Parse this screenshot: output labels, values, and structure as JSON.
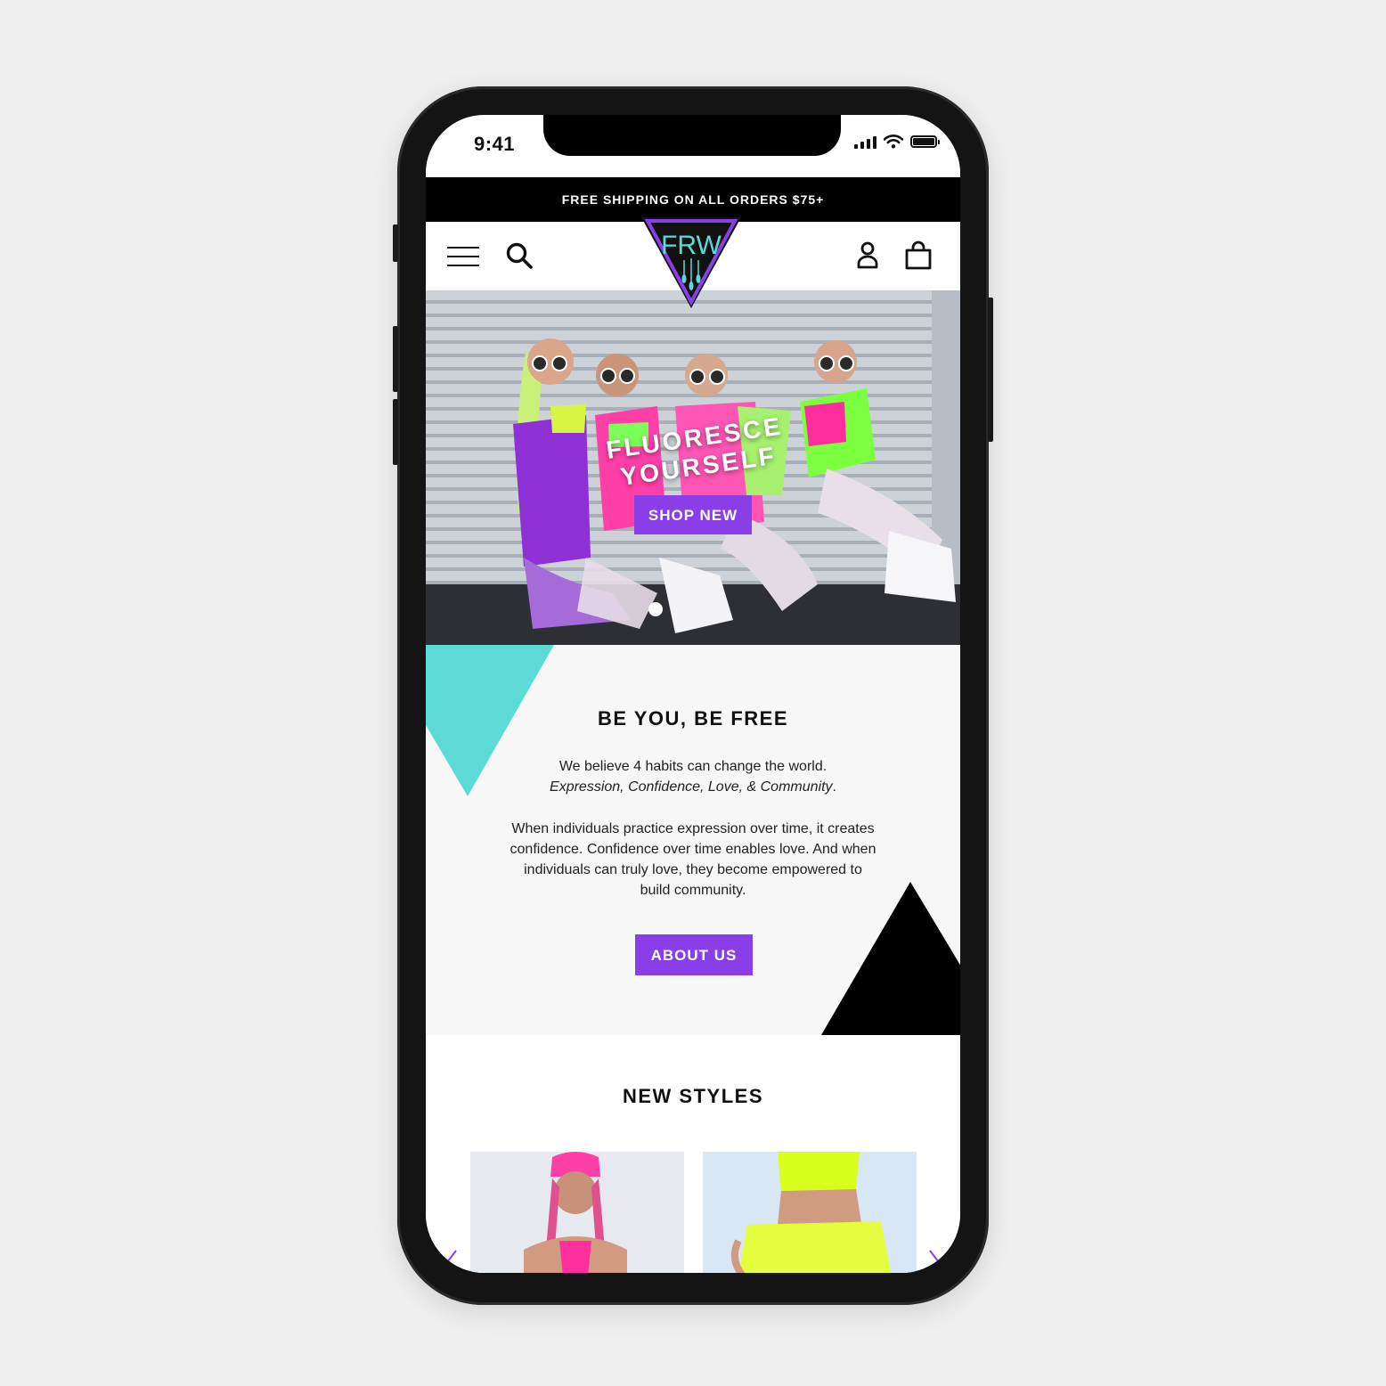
{
  "status": {
    "time": "9:41"
  },
  "promo": {
    "text": "FREE SHIPPING ON ALL ORDERS $75+"
  },
  "brand": {
    "logo_text": "FRW",
    "accent": "#8a3ee8",
    "teal": "#5ddad6"
  },
  "hero": {
    "title": "FLUORESCE YOURSELF",
    "cta": "SHOP NEW"
  },
  "about": {
    "heading": "BE YOU, BE FREE",
    "line1": "We believe 4 habits can change the world.",
    "line2": "Expression, Confidence, Love, & Community",
    "line2_end": ".",
    "body": "When individuals practice expression over time, it creates confidence. Confidence over time enables love. And when individuals can truly love, they become empowered to build community.",
    "cta": "ABOUT US"
  },
  "styles": {
    "heading": "NEW STYLES"
  },
  "icons": [
    "menu-icon",
    "search-icon",
    "account-icon",
    "cart-icon",
    "chevron-left-icon",
    "chevron-right-icon"
  ]
}
